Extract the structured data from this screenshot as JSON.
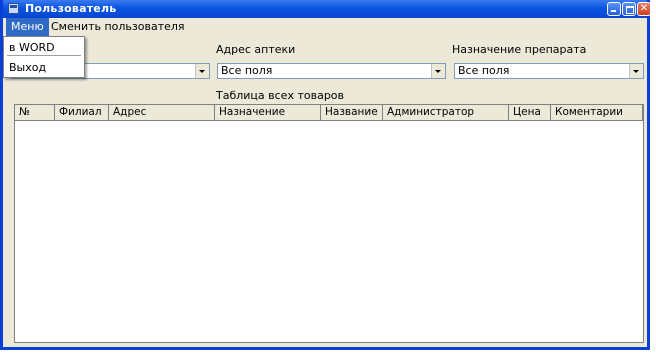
{
  "window": {
    "title": "Пользователь",
    "controls": [
      "minimize",
      "maximize",
      "close"
    ]
  },
  "menubar": {
    "items": [
      "Меню",
      "Сменить пользователя"
    ],
    "open_menu": {
      "items": [
        "в WORD",
        "Выход"
      ]
    }
  },
  "filters": {
    "branch": {
      "label": "",
      "value": ""
    },
    "address": {
      "label": "Адрес аптеки",
      "value": "Все поля"
    },
    "purpose": {
      "label": "Назначение препарата",
      "value": "Все поля"
    }
  },
  "table": {
    "caption": "Таблица всех товаров",
    "columns": [
      "№",
      "Филиал",
      "Адрес",
      "Назначение",
      "Название",
      "Администратор",
      "Цена",
      "Коментарии"
    ],
    "rows": []
  },
  "colors": {
    "titlebar": "#0a54e0",
    "menu_highlight": "#316ac5",
    "window_bg": "#ece9d8"
  }
}
